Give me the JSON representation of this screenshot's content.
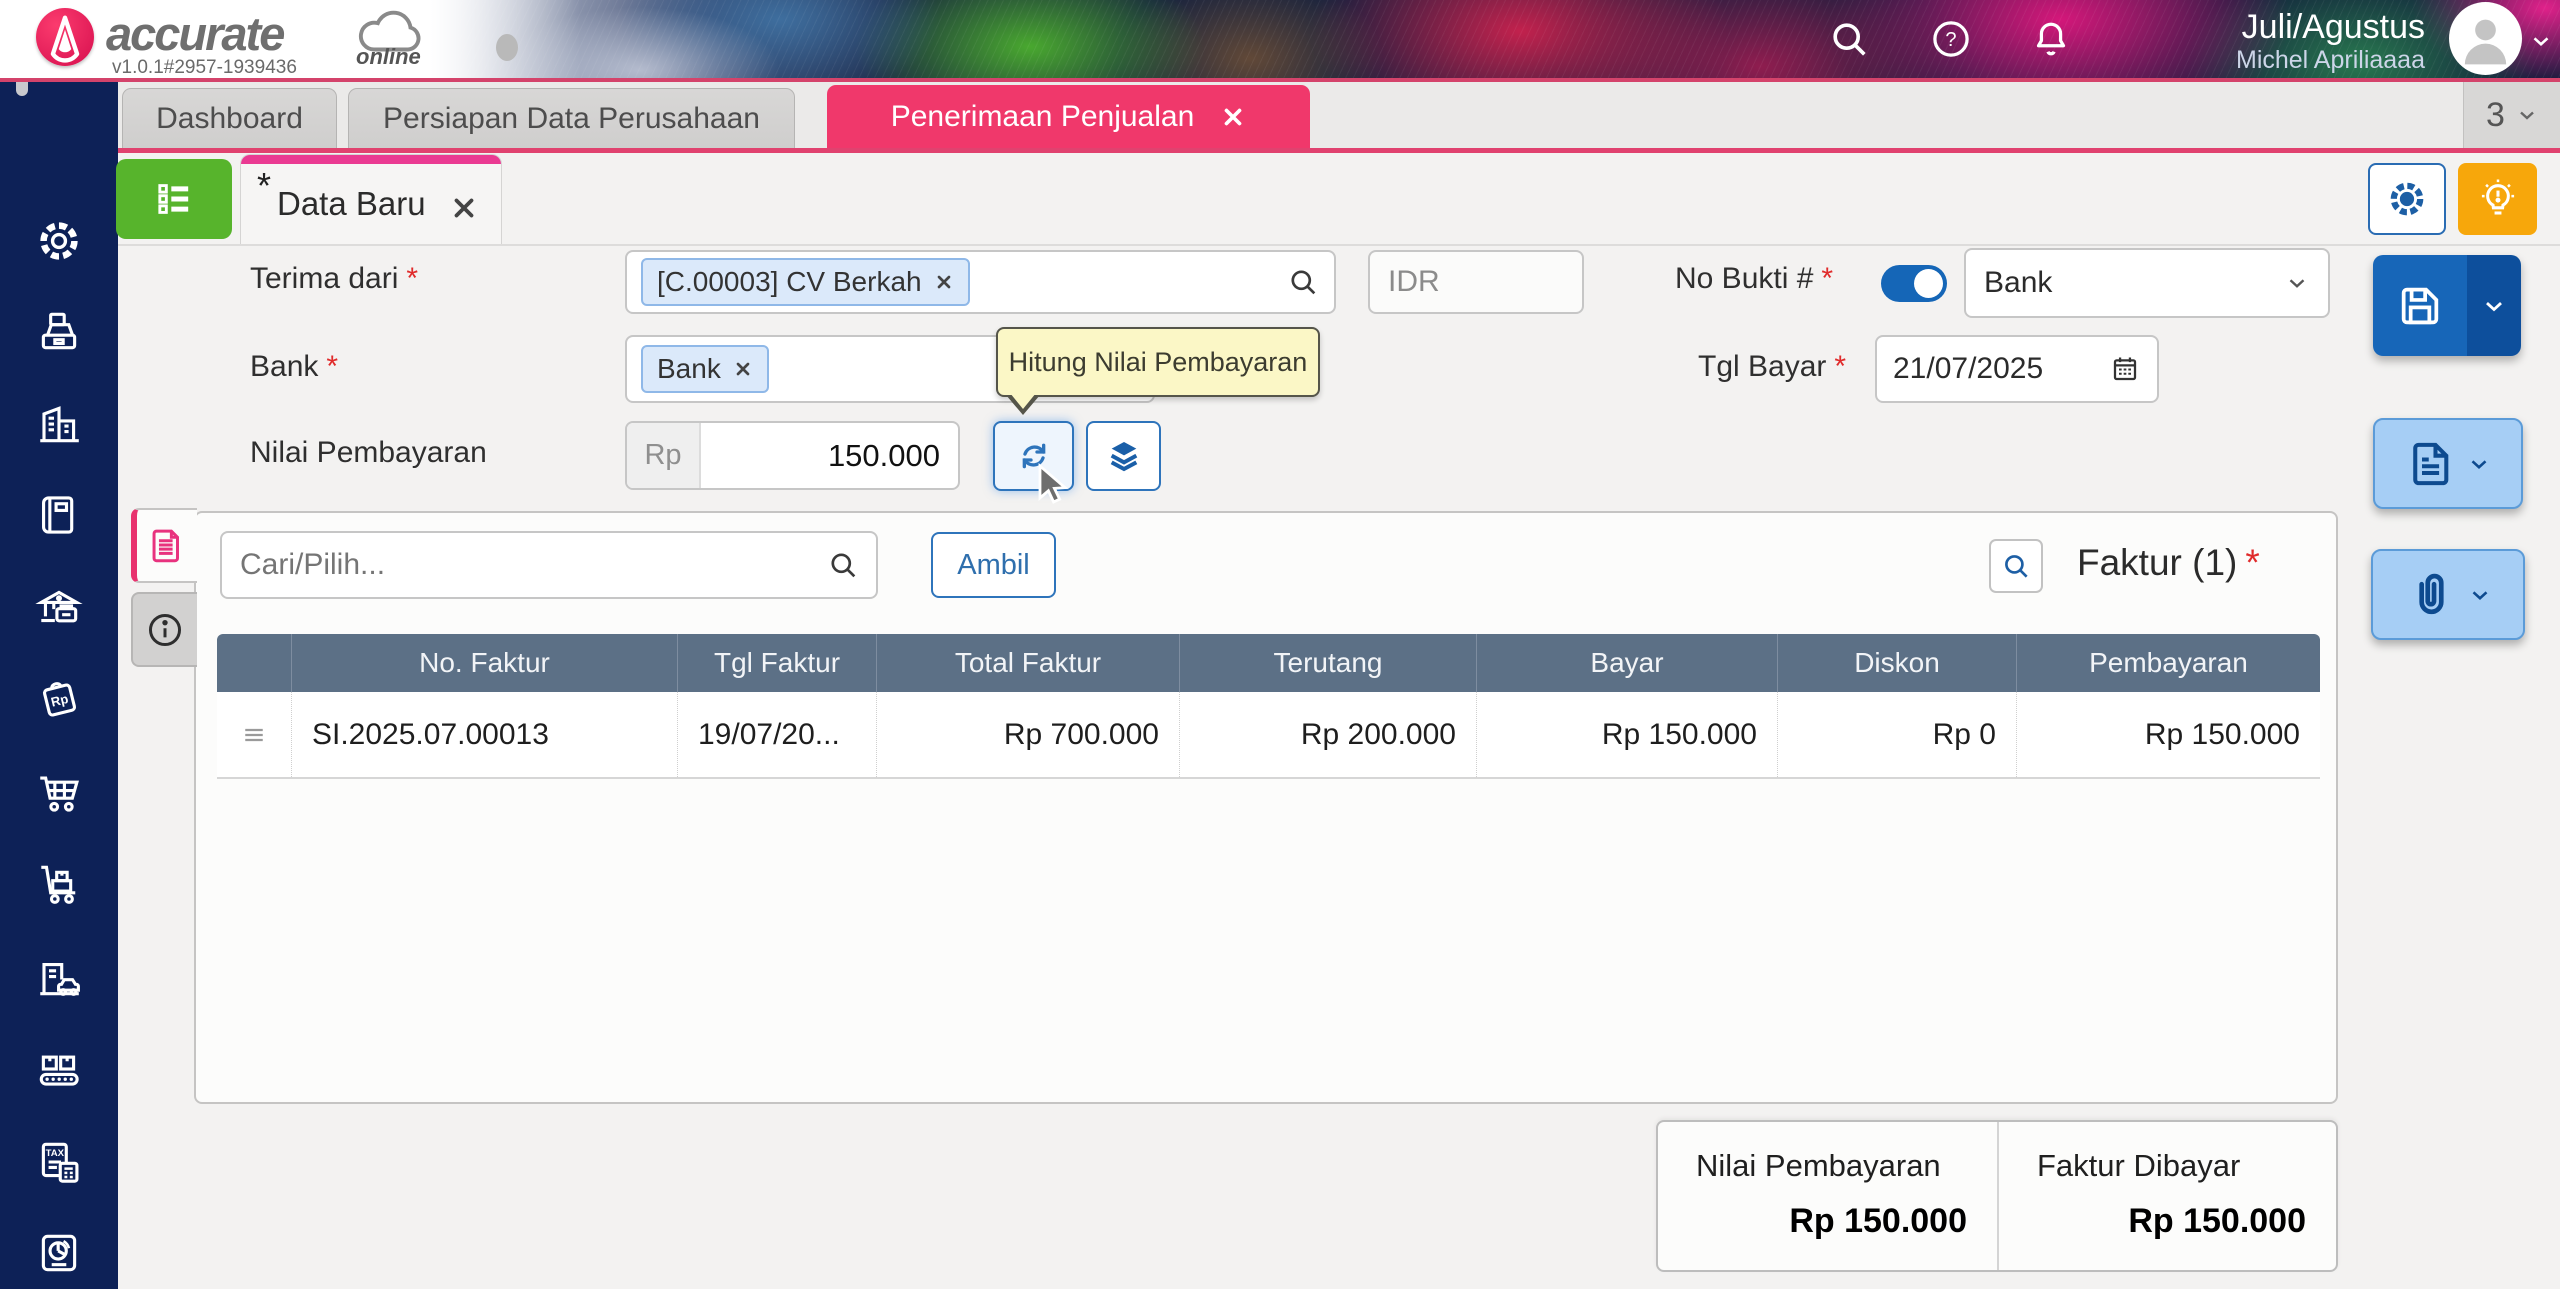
{
  "banner": {
    "logo": "accurate",
    "logo_sub": "online",
    "version": "v1.0.1#2957-1939436",
    "period": "Juli/Agustus",
    "user": "Michel Apriliaaaa"
  },
  "tabbar": {
    "tabs": [
      "Dashboard",
      "Persiapan Data Perusahaan",
      "Penerimaan Penjualan"
    ],
    "active": "Penerimaan Penjualan",
    "counter": "3"
  },
  "doc_tab": {
    "dirty": "*",
    "label": "Data Baru"
  },
  "req": "*",
  "form": {
    "terima_dari_label": "Terima dari",
    "terima_dari_chip": "[C.00003] CV Berkah",
    "currency_value": "IDR",
    "no_bukti_label": "No Bukti #",
    "no_bukti_value": "Bank",
    "bank_label": "Bank",
    "bank_chip": "Bank",
    "tgl_bayar_label": "Tgl Bayar",
    "tgl_bayar_value": "21/07/2025",
    "nilai_label": "Nilai Pembayaran",
    "nilai_prefix": "Rp",
    "nilai_value": "150.000"
  },
  "tooltip": {
    "text": "Hitung Nilai Pembayaran"
  },
  "detail": {
    "search_placeholder": "Cari/Pilih...",
    "ambil": "Ambil",
    "title": "Faktur (1)",
    "columns": [
      "No. Faktur",
      "Tgl Faktur",
      "Total Faktur",
      "Terutang",
      "Bayar",
      "Diskon",
      "Pembayaran"
    ],
    "row": {
      "no_faktur": "SI.2025.07.00013",
      "tgl_faktur": "19/07/20...",
      "total_faktur": "Rp 700.000",
      "terutang": "Rp 200.000",
      "bayar": "Rp 150.000",
      "diskon": "Rp 0",
      "pembayaran": "Rp 150.000"
    }
  },
  "summary": {
    "left_label": "Nilai Pembayaran",
    "left_value": "Rp 150.000",
    "right_label": "Faktur Dibayar",
    "right_value": "Rp 150.000"
  },
  "sidebar": {
    "icons": [
      "settings",
      "cash-register",
      "company",
      "ledger-book",
      "bank-cash",
      "price-tag-rp",
      "sales-cart",
      "purchase-trolley",
      "fixed-asset",
      "manufacture",
      "tax",
      "report"
    ],
    "icon_texts": {
      "price_tag": "Rp",
      "tax": "TAX"
    }
  },
  "colors": {
    "accent_pink": "#f0386b",
    "magenta": "#ea3a92",
    "sidebar_navy": "#0d2157",
    "table_header": "#5c7086",
    "green": "#57b42c",
    "blue": "#1766b8",
    "light_blue": "#a6cef5",
    "orange": "#f7a70b"
  }
}
